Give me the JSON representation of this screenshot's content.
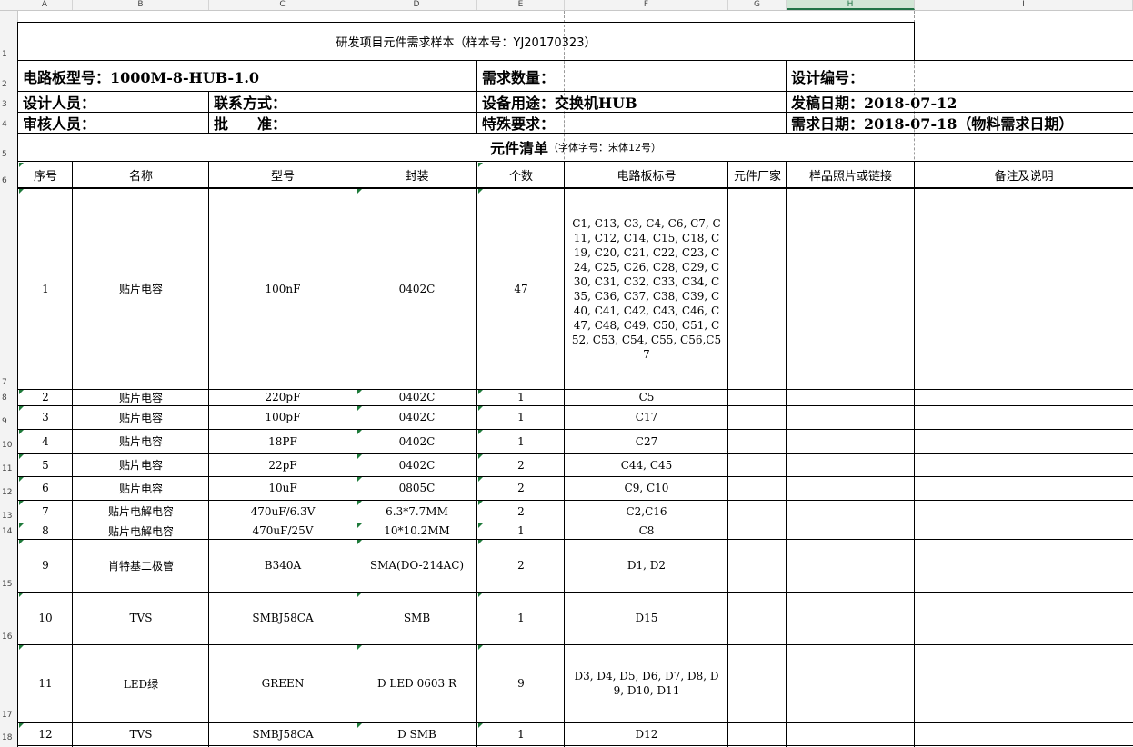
{
  "columns": [
    "A",
    "B",
    "C",
    "D",
    "E",
    "F",
    "G",
    "H",
    "I"
  ],
  "selected_column": "H",
  "title": "研发项目元件需求样本（样本号：YJ20170323）",
  "board_model": "电路板型号：1000M-8-HUB-1.0",
  "demand_qty_label": "需求数量：",
  "design_no_label": "设计编号：",
  "designer_label": "设计人员：",
  "contact_label": "联系方式：",
  "usage_label": "设备用途：交换机HUB",
  "issue_date_label": "发稿日期：2018-07-12",
  "reviewer_label": "审核人员：",
  "approve_label": "批　　准：",
  "special_label": "特殊要求：",
  "need_date_label": "需求日期：2018-07-18（物料需求日期）",
  "list_title": "元件清单",
  "list_note": "（字体字号：宋体12号）",
  "headers": [
    "序号",
    "名称",
    "型号",
    "封装",
    "个数",
    "电路板标号",
    "元件厂家",
    "样品照片或链接",
    "备注及说明"
  ],
  "rows": [
    {
      "no": "1",
      "name": "贴片电容",
      "model": "100nF",
      "pkg": "0402C",
      "qty": "47",
      "ref": "C1, C13, C3, C4, C6, C7, C11, C12, C14, C15, C18, C19, C20, C21, C22, C23, C24, C25, C26, C28, C29, C30, C31, C32, C33, C34, C35, C36, C37, C38, C39, C40, C41, C42, C43, C46, C47, C48, C49, C50, C51, C52, C53, C54, C55, C56,C57"
    },
    {
      "no": "2",
      "name": "贴片电容",
      "model": "220pF",
      "pkg": "0402C",
      "qty": "1",
      "ref": "C5"
    },
    {
      "no": "3",
      "name": "贴片电容",
      "model": "100pF",
      "pkg": "0402C",
      "qty": "1",
      "ref": "C17"
    },
    {
      "no": "4",
      "name": "贴片电容",
      "model": "18PF",
      "pkg": "0402C",
      "qty": "1",
      "ref": "C27"
    },
    {
      "no": "5",
      "name": "贴片电容",
      "model": "22pF",
      "pkg": "0402C",
      "qty": "2",
      "ref": "C44, C45"
    },
    {
      "no": "6",
      "name": "贴片电容",
      "model": "10uF",
      "pkg": "0805C",
      "qty": "2",
      "ref": "C9, C10"
    },
    {
      "no": "7",
      "name": "贴片电解电容",
      "model": "470uF/6.3V",
      "pkg": "6.3*7.7MM",
      "qty": "2",
      "ref": "C2,C16"
    },
    {
      "no": "8",
      "name": "贴片电解电容",
      "model": "470uF/25V",
      "pkg": "10*10.2MM",
      "qty": "1",
      "ref": "C8"
    },
    {
      "no": "9",
      "name": "肖特基二极管",
      "model": "B340A",
      "pkg": "SMA(DO-214AC)",
      "qty": "2",
      "ref": "D1, D2"
    },
    {
      "no": "10",
      "name": "TVS",
      "model": "SMBJ58CA",
      "pkg": "SMB",
      "qty": "1",
      "ref": "D15"
    },
    {
      "no": "11",
      "name": "LED绿",
      "model": "GREEN",
      "pkg": "D LED 0603 R",
      "qty": "9",
      "ref": "D3, D4, D5, D6, D7, D8, D9, D10, D11"
    },
    {
      "no": "12",
      "name": "TVS",
      "model": "SMBJ58CA",
      "pkg": "D SMB",
      "qty": "1",
      "ref": "D12"
    }
  ],
  "row_numbers": [
    "1",
    "2",
    "3",
    "4",
    "5",
    "6",
    "7",
    "8",
    "9",
    "10",
    "11",
    "12",
    "13",
    "14",
    "15",
    "16",
    "17",
    "18"
  ]
}
